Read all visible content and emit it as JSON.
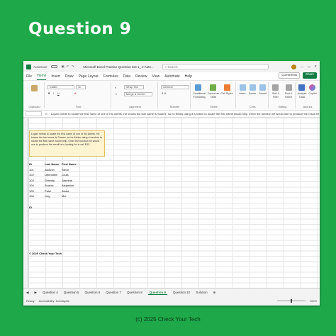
{
  "slide_title": "Question 9",
  "footer": "(c) 2025 Check Your Tech",
  "titlebar": {
    "autosave": "AutoSave",
    "doc_name": "Microsoft Excel Practice Question Set 1_ 2 Auto...",
    "search_placeholder": "Search"
  },
  "menu": [
    "File",
    "Home",
    "Insert",
    "Draw",
    "Page Layout",
    "Formulas",
    "Data",
    "Review",
    "View",
    "Automate",
    "Help"
  ],
  "menu_active": "Home",
  "comments_label": "Comments",
  "share_label": "Share",
  "ribbon": {
    "clipboard": "Clipboard",
    "font_name": "Calibri",
    "font_size": "11",
    "font": "Font",
    "wrap_text": "Wrap Text",
    "merge_center": "Merge & Center",
    "alignment": "Alignment",
    "number_format": "General",
    "number": "Number",
    "cond_format": "Conditional Formatting",
    "format_table": "Format as Table",
    "cell_styles": "Cell Styles",
    "styles": "Styles",
    "insert": "Insert",
    "delete": "Delete",
    "format": "Format",
    "cells": "Cells",
    "sort_filter": "Sort & Filter",
    "find_select": "Find & Select",
    "editing": "Editing",
    "analyze_data": "Analyze Data",
    "copilot": "Copilot",
    "add_ins": "Add-ins"
  },
  "formula_bar": {
    "fx": "fx",
    "text": "Logan needs to locate the first name of one of his clients. He knows the last name is Suarez, so he thinks using a function to locate the first name would help. Enter the function he would use to produce the result he is looking for"
  },
  "question_note": "Logan needs to locate the first name of one of his clients. He knows the last name is Suarez, so he thinks using a function to locate the first name would help. Enter the function he would use to produce the result he's looking for in cell B12.",
  "table": {
    "headers": [
      "ID",
      "Last Name",
      "First Name"
    ],
    "rows": [
      [
        "101",
        "Jackner",
        "Steve"
      ],
      [
        "102",
        "Littenstein",
        "Louis"
      ],
      [
        "103",
        "Greenly",
        "Jasmine"
      ],
      [
        "104",
        "Suarez",
        "Alejandra"
      ],
      [
        "105",
        "Patel",
        "Abdul"
      ],
      [
        "106",
        "Ling",
        "Mei"
      ]
    ],
    "id_label": "ID"
  },
  "copyright_cell": "© 2025 Check Your Tech",
  "sheet_tabs": [
    "Question 4",
    "Question 5",
    "Question 6",
    "Question 7",
    "Question 8",
    "Question 9",
    "Question 10",
    "Solution"
  ],
  "active_sheet": "Question 9",
  "status": {
    "ready": "Ready",
    "accessibility": "Accessibility: Investigate",
    "zoom": "100%"
  }
}
